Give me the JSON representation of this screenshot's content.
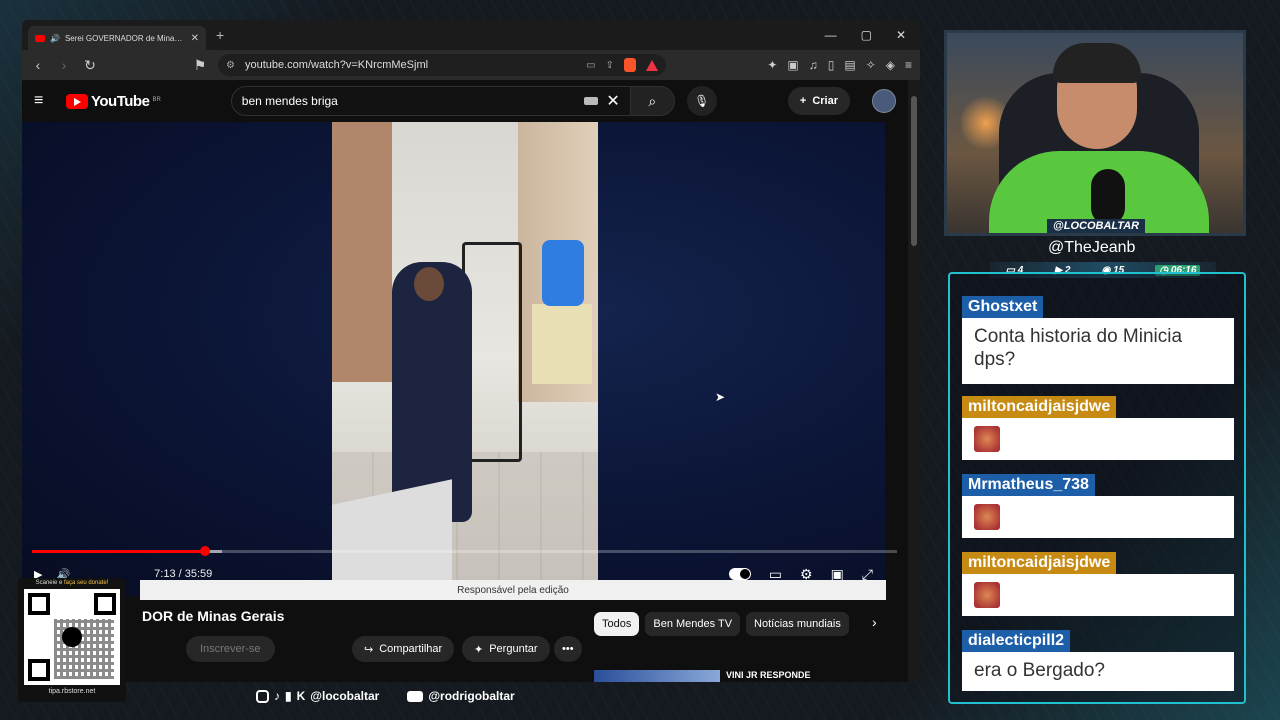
{
  "browser": {
    "tab_title": "Serei GOVERNADOR de Minas Gera",
    "url": "youtube.com/watch?v=KNrcmMeSjml"
  },
  "youtube": {
    "logo": "YouTube",
    "country": "BR",
    "search_query": "ben mendes briga",
    "create_label": "Criar",
    "time": "7:13 / 35:59",
    "progress_fraction": 0.2,
    "video_title": "DOR de Minas Gerais",
    "subscribe_label": "Inscrever-se",
    "share_label": "Compartilhar",
    "ask_label": "Perguntar",
    "chips": [
      "Todos",
      "Ben Mendes TV",
      "Notícias mundiais"
    ],
    "rec_title": "VINI JR RESPONDE",
    "editor_notice": "Responsável pela edição"
  },
  "overlay": {
    "qr_caption_a": "Scaneie e ",
    "qr_caption_b": "faça seu donate!",
    "qr_site": "tipa.rbstore.net",
    "social_a": "@locobaltar",
    "social_b": "@rodrigobaltar",
    "handle_top": "@LOCOBALTAR",
    "handle_main": "@TheJeanb",
    "stats": [
      "4",
      "2",
      "15",
      "06:16"
    ]
  },
  "chat": [
    {
      "user": "Ghostxet",
      "color": "#1d5ea8",
      "text": "Conta historia do Minicia dps?"
    },
    {
      "user": "miltoncaidjaisjdwe",
      "color": "#c78a12",
      "text": ""
    },
    {
      "user": "Mrmatheus_738",
      "color": "#1d5ea8",
      "text": ""
    },
    {
      "user": "miltoncaidjaisjdwe",
      "color": "#c78a12",
      "text": ""
    },
    {
      "user": "dialecticpill2",
      "color": "#1d5ea8",
      "text": "era o Bergado?"
    }
  ],
  "colors": {
    "accent": "#20c0d0",
    "yt_red": "#ff0000"
  }
}
